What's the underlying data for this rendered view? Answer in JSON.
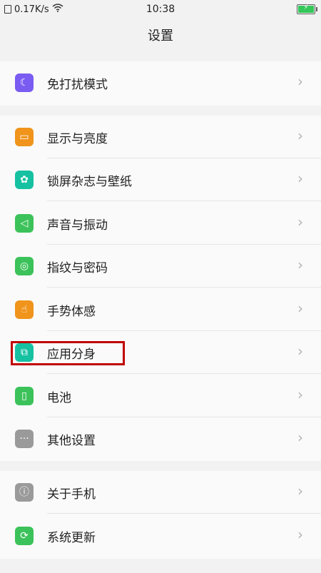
{
  "status_bar": {
    "net_speed": "0.17K/s",
    "time": "10:38",
    "battery_icon": "battery-charging-icon",
    "wifi_icon": "wifi-icon",
    "sim_icon": "sim-card-icon"
  },
  "header": {
    "title": "设置"
  },
  "groups": [
    {
      "items": [
        {
          "label": "免打扰模式",
          "icon": "moon-icon",
          "color": "#7a5cf2"
        }
      ]
    },
    {
      "items": [
        {
          "label": "显示与亮度",
          "icon": "display-icon",
          "color": "#f0941c"
        },
        {
          "label": "锁屏杂志与壁纸",
          "icon": "flower-icon",
          "color": "#16c1a2"
        },
        {
          "label": "声音与振动",
          "icon": "speaker-icon",
          "color": "#3cc25a"
        },
        {
          "label": "指纹与密码",
          "icon": "fingerprint-icon",
          "color": "#3cc25a"
        },
        {
          "label": "手势体感",
          "icon": "hand-icon",
          "color": "#f0941c"
        },
        {
          "label": "应用分身",
          "icon": "app-clone-icon",
          "color": "#16c1a2"
        },
        {
          "label": "电池",
          "icon": "battery-icon",
          "color": "#3cc25a"
        },
        {
          "label": "其他设置",
          "icon": "more-icon",
          "color": "#9a9a9a"
        }
      ]
    },
    {
      "items": [
        {
          "label": "关于手机",
          "icon": "info-icon",
          "color": "#9a9a9a"
        },
        {
          "label": "系统更新",
          "icon": "update-icon",
          "color": "#3cc25a"
        }
      ]
    }
  ],
  "highlight_color": "#c00000"
}
